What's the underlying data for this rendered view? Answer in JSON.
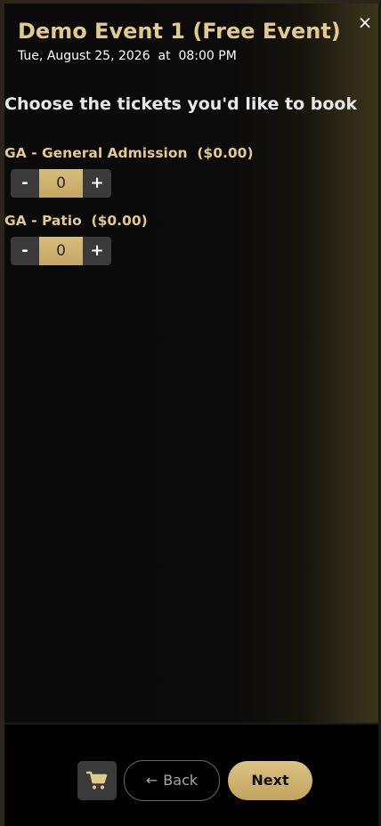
{
  "event": {
    "title": "Demo Event 1 (Free Event)",
    "datetime": "Tue, August 25, 2026  at  08:00 PM"
  },
  "close_label": "×",
  "heading": "Choose the tickets you'd like to book",
  "tickets": [
    {
      "label": "GA - General Admission  ($0.00)",
      "minus": "-",
      "quantity": "0",
      "plus": "+"
    },
    {
      "label": "GA - Patio  ($0.00)",
      "minus": "-",
      "quantity": "0",
      "plus": "+"
    }
  ],
  "footer": {
    "cart_icon": "cart-icon",
    "back_arrow": "←",
    "back_label": "Back",
    "next_label": "Next"
  },
  "colors": {
    "accent_gold": "#e2c98c",
    "button_gold": "#d7bd7c",
    "dark_button": "#3a3a3a"
  }
}
